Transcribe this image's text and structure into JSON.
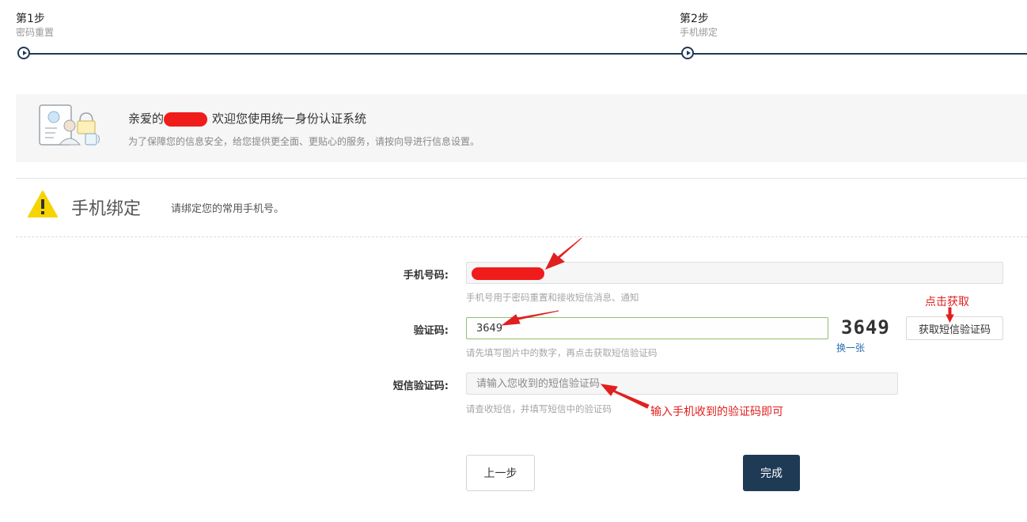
{
  "steps": [
    {
      "title": "第1步",
      "subtitle": "密码重置"
    },
    {
      "title": "第2步",
      "subtitle": "手机绑定"
    }
  ],
  "welcome": {
    "greeting_prefix": "亲爱的",
    "greeting_suffix": "欢迎您使用统一身份认证系统",
    "subtitle": "为了保障您的信息安全，给您提供更全面、更贴心的服务，请按向导进行信息设置。",
    "icon": "identity-card-icon"
  },
  "section": {
    "icon": "warning-icon",
    "title": "手机绑定",
    "description": "请绑定您的常用手机号。"
  },
  "form": {
    "phone": {
      "label": "手机号码:",
      "hint": "手机号用于密码重置和接收短信消息、通知"
    },
    "captcha": {
      "label": "验证码:",
      "value": "3649",
      "hint": "请先填写图片中的数字，再点击获取短信验证码",
      "image_text": "3649",
      "refresh_label": "换一张",
      "sms_button_label": "获取短信验证码"
    },
    "sms_code": {
      "label": "短信验证码:",
      "placeholder": "请输入您收到的短信验证码",
      "hint": "请查收短信，并填写短信中的验证码"
    }
  },
  "buttons": {
    "prev": "上一步",
    "done": "完成"
  },
  "annotations": {
    "click_get": "点击获取",
    "enter_code": "输入手机收到的验证码即可"
  },
  "colors": {
    "primary": "#1f3a55",
    "annotation": "#e02020",
    "warning": "#f5d400",
    "link": "#2a6fb0"
  }
}
